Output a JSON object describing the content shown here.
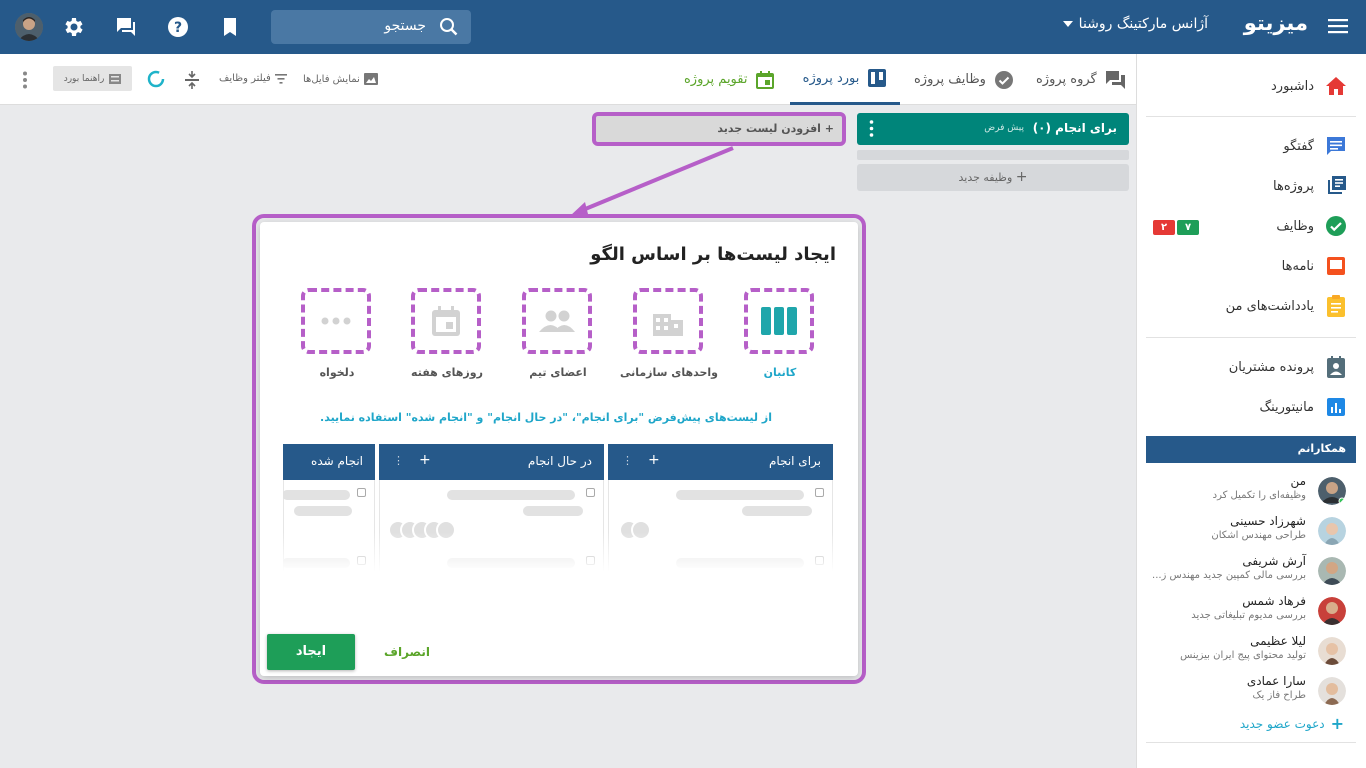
{
  "topbar": {
    "brand": "میزیتو",
    "agency": "آژانس مارکتینگ روشنا",
    "search_placeholder": "جستجو"
  },
  "sidebar": {
    "items": [
      {
        "label": "داشبورد"
      },
      {
        "label": "گفتگو"
      },
      {
        "label": "پروژه‌ها"
      },
      {
        "label": "وظایف"
      },
      {
        "label": "نامه‌ها"
      },
      {
        "label": "یادداشت‌های من"
      },
      {
        "label": "پرونده مشتریان"
      },
      {
        "label": "مانیتورینگ"
      }
    ],
    "task_badges": {
      "green": "۷",
      "red": "۲"
    },
    "team_title": "همکارانم",
    "members": [
      {
        "name": "من",
        "desc": "وظیفه‌ای را تکمیل کرد"
      },
      {
        "name": "شهرزاد حسینی",
        "desc": "طراحی مهندس اشکان"
      },
      {
        "name": "آرش شریفی",
        "desc": "بررسی مالی کمپین جدید مهندس ز..."
      },
      {
        "name": "فرهاد شمس",
        "desc": "بررسی مدیوم تبلیغاتی جدید"
      },
      {
        "name": "لیلا عظیمی",
        "desc": "تولید محتوای پیج ایران بیزینس"
      },
      {
        "name": "سارا عمادی",
        "desc": "طراح فاز یک"
      }
    ],
    "invite": "دعوت عضو جدید"
  },
  "tabs": [
    {
      "label": "گروه پروژه"
    },
    {
      "label": "وظایف پروژه"
    },
    {
      "label": "بورد پروژه"
    },
    {
      "label": "تقویم پروژه"
    }
  ],
  "tools": {
    "files": "نمایش فایل‌ها",
    "filter": "فیلتر وظایف",
    "guide": "راهنما بورد"
  },
  "board": {
    "list_title": "برای انجام (۰)",
    "list_default": "پیش فرض",
    "new_task": "وظیفه جدید",
    "add_list": "+ افزودن لیست جدید"
  },
  "modal": {
    "title": "ایجاد لیست‌ها بر اساس الگو",
    "templates": [
      {
        "label": "کانبان"
      },
      {
        "label": "واحدهای سازمانی"
      },
      {
        "label": "اعضای تیم"
      },
      {
        "label": "روزهای هفته"
      },
      {
        "label": "دلخواه"
      }
    ],
    "note": "از لیست‌های پیش‌فرض \"برای انجام\"، \"در حال انجام\" و \"انجام شده\" استفاده نمایید.",
    "preview_columns": [
      {
        "title": "برای انجام"
      },
      {
        "title": "در حال انجام"
      },
      {
        "title": "انجام شده"
      }
    ],
    "create": "ایجاد",
    "cancel": "انصراف"
  },
  "colors": {
    "topbar": "#26598a",
    "accent_teal": "#00857a",
    "highlight": "#b65fc8",
    "create_green": "#1e9e58"
  }
}
